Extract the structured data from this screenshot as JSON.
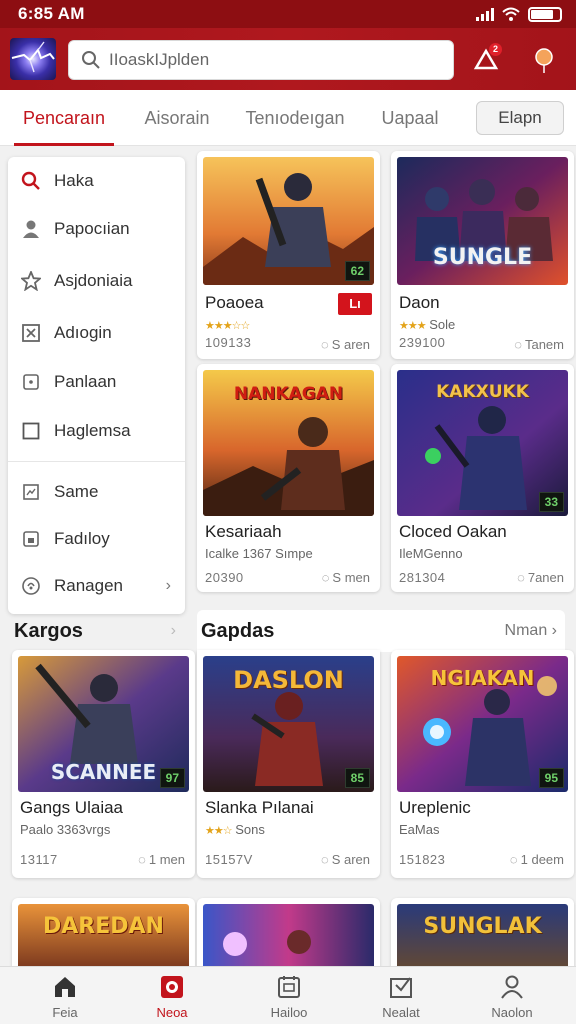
{
  "status_bar": {
    "time": "6:85 AM"
  },
  "header": {
    "search_placeholder": "IIoaskIJplden",
    "notification_count": "2"
  },
  "tabs": {
    "items": [
      {
        "label": "Pencaraın"
      },
      {
        "label": "Aisorain"
      },
      {
        "label": "Tenıodeıgan"
      },
      {
        "label": "Uapaal"
      }
    ],
    "button_label": "Elapn"
  },
  "side_menu": {
    "items": [
      {
        "label": "Haka",
        "icon": "search-icon"
      },
      {
        "label": "Papocıian",
        "icon": "user-icon"
      },
      {
        "label": "Asjdoniaia",
        "icon": "star-icon"
      },
      {
        "label": "Adıogin",
        "icon": "puzzle-icon"
      },
      {
        "label": "Panlaan",
        "icon": "square-dot-icon"
      },
      {
        "label": "Haglemsa",
        "icon": "square-icon"
      },
      {
        "label": "Same",
        "icon": "image-icon"
      },
      {
        "label": "Fadıloy",
        "icon": "bookmark-icon"
      },
      {
        "label": "Ranagen",
        "icon": "compass-icon"
      }
    ]
  },
  "grid": {
    "cards": [
      {
        "title": "Poaoea",
        "sub": "",
        "badge": "Lı",
        "meta_left": "109133",
        "meta_right": "S aren",
        "score": "62"
      },
      {
        "title": "Daon",
        "sub": "Sole",
        "thumb_text": "SUNGLE",
        "meta_left": "239100",
        "meta_right": "Tanem"
      },
      {
        "title": "Kesariaah",
        "sub": "Icalke 1367 Sımpe",
        "thumb_text": "NANKAGAN",
        "meta_left": "20390",
        "meta_right": "S men"
      },
      {
        "title": "Cloced Oakan",
        "sub": "IleMGenno",
        "thumb_text": "KAKXUKK",
        "meta_left": "281304",
        "meta_right": "7anen",
        "score": "33"
      }
    ]
  },
  "sections": {
    "left_title": "Kargos",
    "right_title": "Gapdas",
    "right_more": "Nman"
  },
  "row_cards": [
    {
      "title": "Gangs Ulaiaa",
      "sub": "Paalo 3363vrgs",
      "thumb_text": "SCANNEE",
      "meta_left": "13117",
      "meta_right": "1 men",
      "score": "97"
    },
    {
      "title": "Slanka Pılanai",
      "sub": "Sons",
      "thumb_text": "DASLON",
      "meta_left": "15157V",
      "meta_right": "S aren",
      "score": "85"
    },
    {
      "title": "Ureplenic",
      "sub": "EaMas",
      "thumb_text": "NGIAKAN",
      "meta_left": "151823",
      "meta_right": "1 deem",
      "score": "95"
    }
  ],
  "peek_cards": [
    {
      "thumb_text": "DAREDAN"
    },
    {
      "thumb_text": ""
    },
    {
      "thumb_text": "SUNGLAK"
    }
  ],
  "bottom_nav": {
    "items": [
      {
        "label": "Feia",
        "icon": "home-icon"
      },
      {
        "label": "Neoa",
        "icon": "media-icon"
      },
      {
        "label": "Hailoo",
        "icon": "calendar-icon"
      },
      {
        "label": "Nealat",
        "icon": "inbox-icon"
      },
      {
        "label": "Naolon",
        "icon": "profile-icon"
      }
    ]
  },
  "colors": {
    "primary": "#b0181e",
    "accent_text": "#c2141c",
    "star": "#e3a31a"
  }
}
